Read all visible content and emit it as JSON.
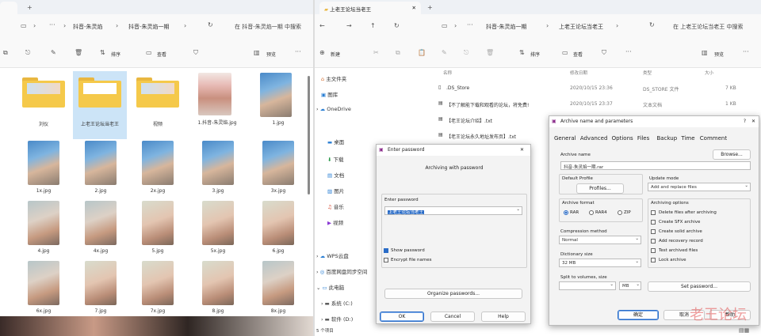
{
  "left_window": {
    "breadcrumb": [
      "抖音-朱灵焰",
      "抖音-朱灵焰一期"
    ],
    "search_placeholder": "在 抖音-朱灵焰一期 中搜索",
    "toolbar": {
      "sort": "排序",
      "view": "查看",
      "preview": "预览"
    },
    "files": [
      {
        "name": "刘仪",
        "kind": "folder"
      },
      {
        "name": "上老王论坛当老王",
        "kind": "folder"
      },
      {
        "name": "视频",
        "kind": "folder"
      },
      {
        "name": "1.抖音-朱灵焰.jpg",
        "kind": "image"
      },
      {
        "name": "1.jpg",
        "kind": "image"
      },
      {
        "name": "1x.jpg",
        "kind": "image"
      },
      {
        "name": "2.jpg",
        "kind": "image"
      },
      {
        "name": "2x.jpg",
        "kind": "image"
      },
      {
        "name": "3.jpg",
        "kind": "image"
      },
      {
        "name": "3x.jpg",
        "kind": "image"
      },
      {
        "name": "4.jpg",
        "kind": "image"
      },
      {
        "name": "4x.jpg",
        "kind": "image"
      },
      {
        "name": "5.jpg",
        "kind": "image"
      },
      {
        "name": "5x.jpg",
        "kind": "image"
      },
      {
        "name": "6.jpg",
        "kind": "image"
      },
      {
        "name": "6x.jpg",
        "kind": "image"
      },
      {
        "name": "7.jpg",
        "kind": "image"
      },
      {
        "name": "7x.jpg",
        "kind": "image"
      },
      {
        "name": "8.jpg",
        "kind": "image"
      },
      {
        "name": "8x.jpg",
        "kind": "image"
      }
    ]
  },
  "right_window": {
    "tab_title": "上老王论坛当老王",
    "breadcrumb": [
      "抖音-朱灵焰一期",
      "上老王论坛当老王"
    ],
    "search_placeholder": "在 上老王论坛当老王 中搜索",
    "toolbar": {
      "new": "新建",
      "sort": "排序",
      "view": "查看",
      "preview": "预览"
    },
    "nav": [
      "主文件夹",
      "图库",
      "OneDrive",
      "桌面",
      "下载",
      "文档",
      "图片",
      "音乐",
      "视频",
      "WPS云盘",
      "百度网盘同步空间",
      "此电脑",
      "系统 (C:)",
      "软件 (D:)"
    ],
    "columns": {
      "name": "名称",
      "date": "修改日期",
      "type": "类型",
      "size": "大小"
    },
    "rows": [
      {
        "name": ".DS_Store",
        "date": "2020/10/15 23:36",
        "type": "DS_STORE 文件",
        "size": "7 KB"
      },
      {
        "name": "【不了解能下载和观看的论坛，将免费!",
        "date": "2020/10/15 23:37",
        "type": "文本文档",
        "size": "1 KB"
      },
      {
        "name": "【老王论坛介绍】.txt",
        "date": "",
        "type": "",
        "size": ""
      },
      {
        "name": "【老王论坛永久地址发布页】.txt",
        "date": "",
        "type": "",
        "size": ""
      }
    ],
    "status": "5 个项目"
  },
  "password_dialog": {
    "title": "Enter password",
    "subtitle": "Archiving with password",
    "label": "Enter password",
    "value": "上老王论坛当老王",
    "show_password": "Show password",
    "encrypt_names": "Encrypt file names",
    "organize": "Organize passwords...",
    "ok": "OK",
    "cancel": "Cancel",
    "help": "Help"
  },
  "archive_dialog": {
    "title": "Archive name and parameters",
    "tabs": [
      "General",
      "Advanced",
      "Options",
      "Files",
      "Backup",
      "Time",
      "Comment"
    ],
    "archive_name_label": "Archive name",
    "browse": "Browse...",
    "archive_name": "抖音-朱灵焰一期.rar",
    "default_profile": "Default Profile",
    "profiles": "Profiles...",
    "update_mode_label": "Update mode",
    "update_mode": "Add and replace files",
    "format_label": "Archive format",
    "formats": [
      "RAR",
      "RAR4",
      "ZIP"
    ],
    "options_label": "Archiving options",
    "options": [
      "Delete files after archiving",
      "Create SFX archive",
      "Create solid archive",
      "Add recovery record",
      "Test archived files",
      "Lock archive"
    ],
    "compression_label": "Compression method",
    "compression": "Normal",
    "dict_label": "Dictionary size",
    "dict": "32 MB",
    "split_label": "Split to volumes, size",
    "split_unit": "MB",
    "set_password": "Set password...",
    "ok": "确定",
    "cancel": "取消",
    "help": "帮助"
  },
  "watermark": "老王论坛"
}
